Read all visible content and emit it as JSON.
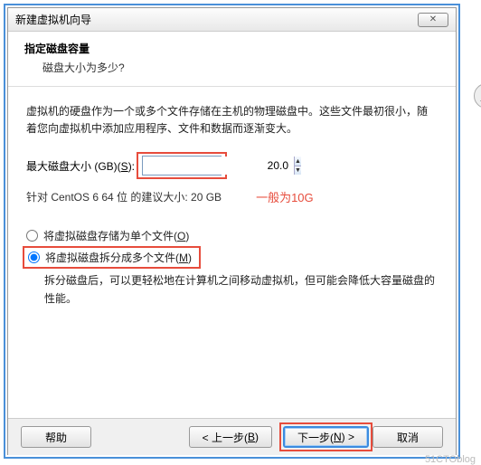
{
  "titlebar": {
    "title": "新建虚拟机向导",
    "close": "✕"
  },
  "header": {
    "title": "指定磁盘容量",
    "subtitle": "磁盘大小为多少?"
  },
  "description": "虚拟机的硬盘作为一个或多个文件存储在主机的物理磁盘中。这些文件最初很小，随着您向虚拟机中添加应用程序、文件和数据而逐渐变大。",
  "size": {
    "label_pre": "最大磁盘大小 (GB)(",
    "label_mnemonic": "S",
    "label_post": "):",
    "value": "20.0"
  },
  "recommended": "针对 CentOS 6 64 位 的建议大小: 20 GB",
  "annotation": "一般为10G",
  "radios": {
    "single_pre": "将虚拟磁盘存储为单个文件(",
    "single_mn": "O",
    "single_post": ")",
    "split_pre": "将虚拟磁盘拆分成多个文件(",
    "split_mn": "M",
    "split_post": ")"
  },
  "split_description": "拆分磁盘后，可以更轻松地在计算机之间移动虚拟机，但可能会降低大容量磁盘的性能。",
  "buttons": {
    "help": "帮助",
    "back_pre": "< 上一步(",
    "back_mn": "B",
    "back_post": ")",
    "next_pre": "下一步(",
    "next_mn": "N",
    "next_post": ") >",
    "cancel": "取消"
  },
  "watermark": "blog"
}
